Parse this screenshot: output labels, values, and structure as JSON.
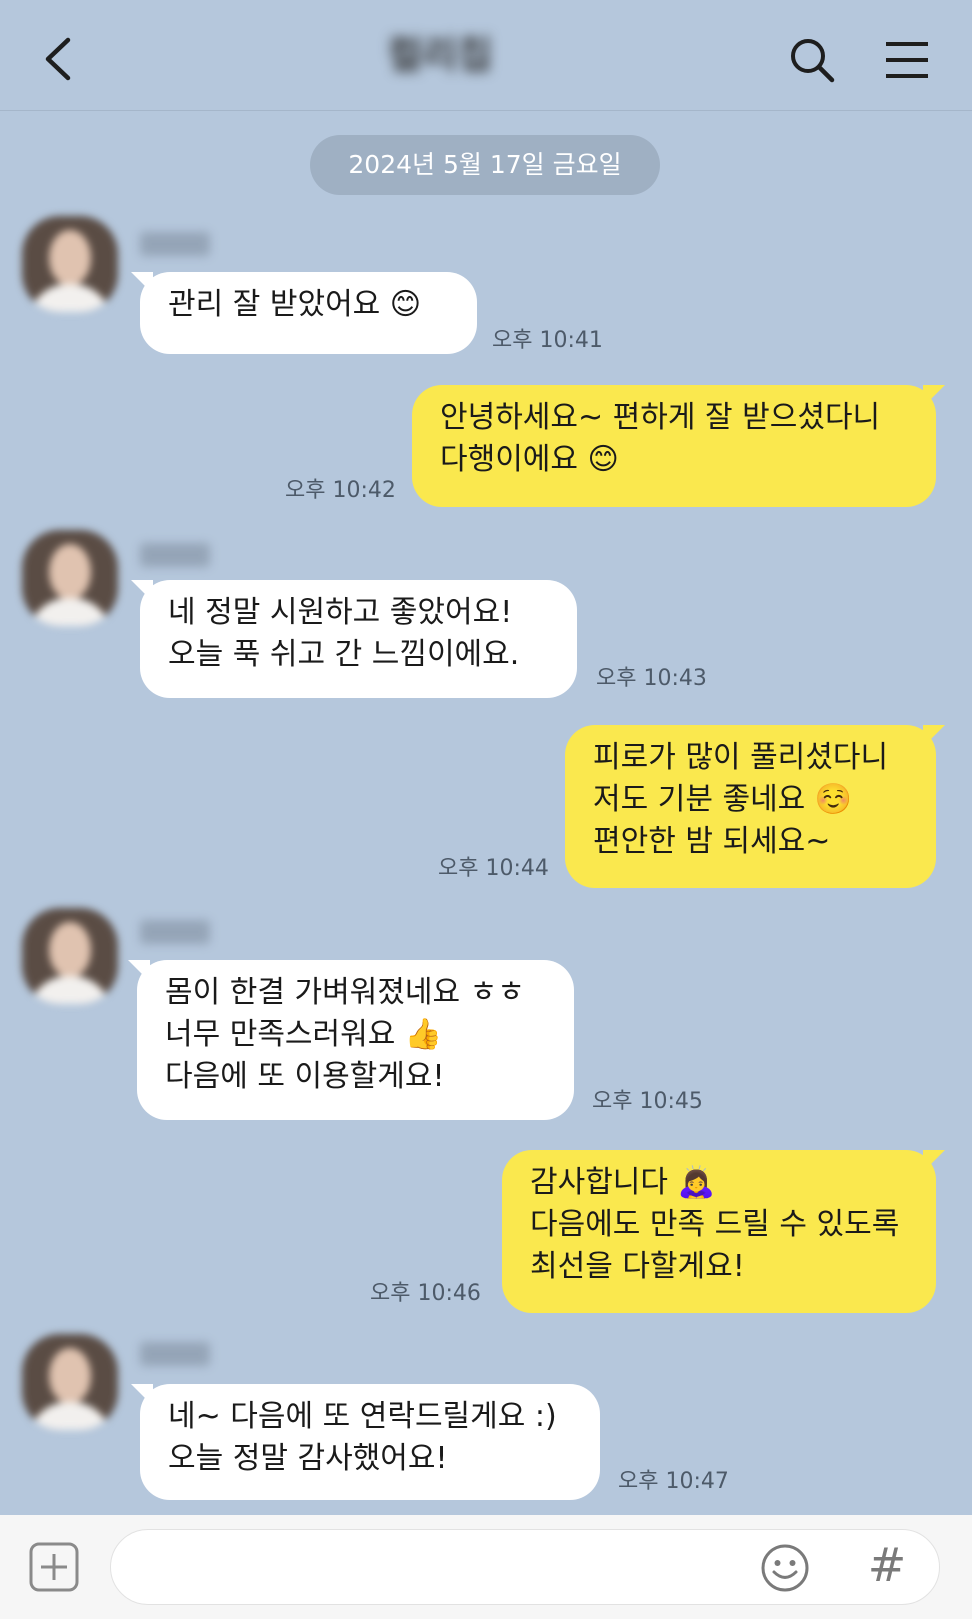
{
  "header": {
    "title": "컬리칩"
  },
  "date_divider": "2024년 5월 17일 금요일",
  "messages": [
    {
      "side": "in",
      "text": "관리 잘 받았어요 😊",
      "time": "오후 10:41"
    },
    {
      "side": "out",
      "text": "안녕하세요~ 편하게 잘 받으셨다니\n다행이에요 😊",
      "time": "오후 10:42"
    },
    {
      "side": "in",
      "text": "네 정말 시원하고 좋았어요!\n오늘 푹 쉬고 간 느낌이에요.",
      "time": "오후 10:43"
    },
    {
      "side": "out",
      "text": "피로가 많이 풀리셨다니\n저도 기분 좋네요 ☺️\n편안한 밤 되세요~",
      "time": "오후 10:44"
    },
    {
      "side": "in",
      "text": "몸이 한결 가벼워졌네요 ㅎㅎ\n너무 만족스러워요 👍\n다음에 또 이용할게요!",
      "time": "오후 10:45"
    },
    {
      "side": "out",
      "text": "감사합니다 🙇‍♀️\n다음에도 만족 드릴 수 있도록\n최선을 다할게요!",
      "time": "오후 10:46"
    },
    {
      "side": "in",
      "text": "네~ 다음에 또 연락드릴게요 :)\n오늘 정말 감사했어요!",
      "time": "오후 10:47"
    }
  ],
  "input_bar": {
    "placeholder": "",
    "hash_label": "#"
  },
  "colors": {
    "background": "#b5c7dc",
    "outgoing_bubble": "#fae84e",
    "incoming_bubble": "#ffffff"
  }
}
